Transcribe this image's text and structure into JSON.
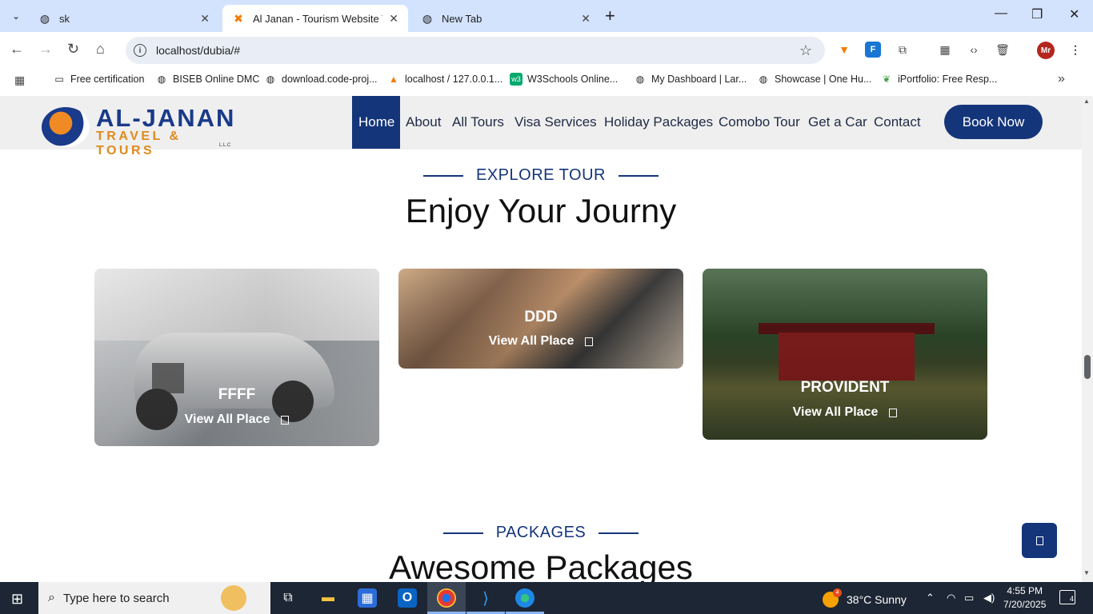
{
  "browser": {
    "tabs": [
      {
        "title": "sk",
        "favicon": "globe-icon",
        "active": false
      },
      {
        "title": "Al Janan - Tourism Website Tem",
        "favicon": "xampp-icon",
        "active": true
      },
      {
        "title": "New Tab",
        "favicon": "chrome-icon",
        "active": false
      }
    ],
    "url": "localhost/dubia/#",
    "bookmarks": [
      "Free certification",
      "BISEB Online DMC",
      "download.code-proj...",
      "localhost / 127.0.0.1...",
      "W3Schools Online...",
      "My Dashboard | Lar...",
      "Showcase | One Hu...",
      "iPortfolio: Free Resp..."
    ],
    "profile_initials": "Mr"
  },
  "site": {
    "logo": {
      "brand": "AL-JANAN",
      "tagline": "TRAVEL & TOURS",
      "suffix": "L.L.C"
    },
    "nav": [
      "Home",
      "About",
      "All Tours",
      "Visa Services",
      "Holiday Packages",
      "Comobo Tour",
      "Get a Car",
      "Contact"
    ],
    "active_nav": "Home",
    "book_now": "Book Now",
    "explore": {
      "tag": "EXPLORE TOUR",
      "title": "Enjoy Your Journy",
      "cards": [
        {
          "name": "FFFF",
          "link": "View All Place"
        },
        {
          "name": "DDD",
          "link": "View All Place"
        },
        {
          "name": "PROVIDENT",
          "link": "View All Place"
        }
      ]
    },
    "packages": {
      "tag": "PACKAGES",
      "title": "Awesome Packages"
    }
  },
  "taskbar": {
    "search_placeholder": "Type here to search",
    "weather": "38°C  Sunny",
    "weather_badge": "4",
    "time": "4:55 PM",
    "date": "7/20/2025",
    "notifications": "4"
  },
  "colors": {
    "brand_blue": "#14357a",
    "brand_orange": "#e08a1e"
  }
}
